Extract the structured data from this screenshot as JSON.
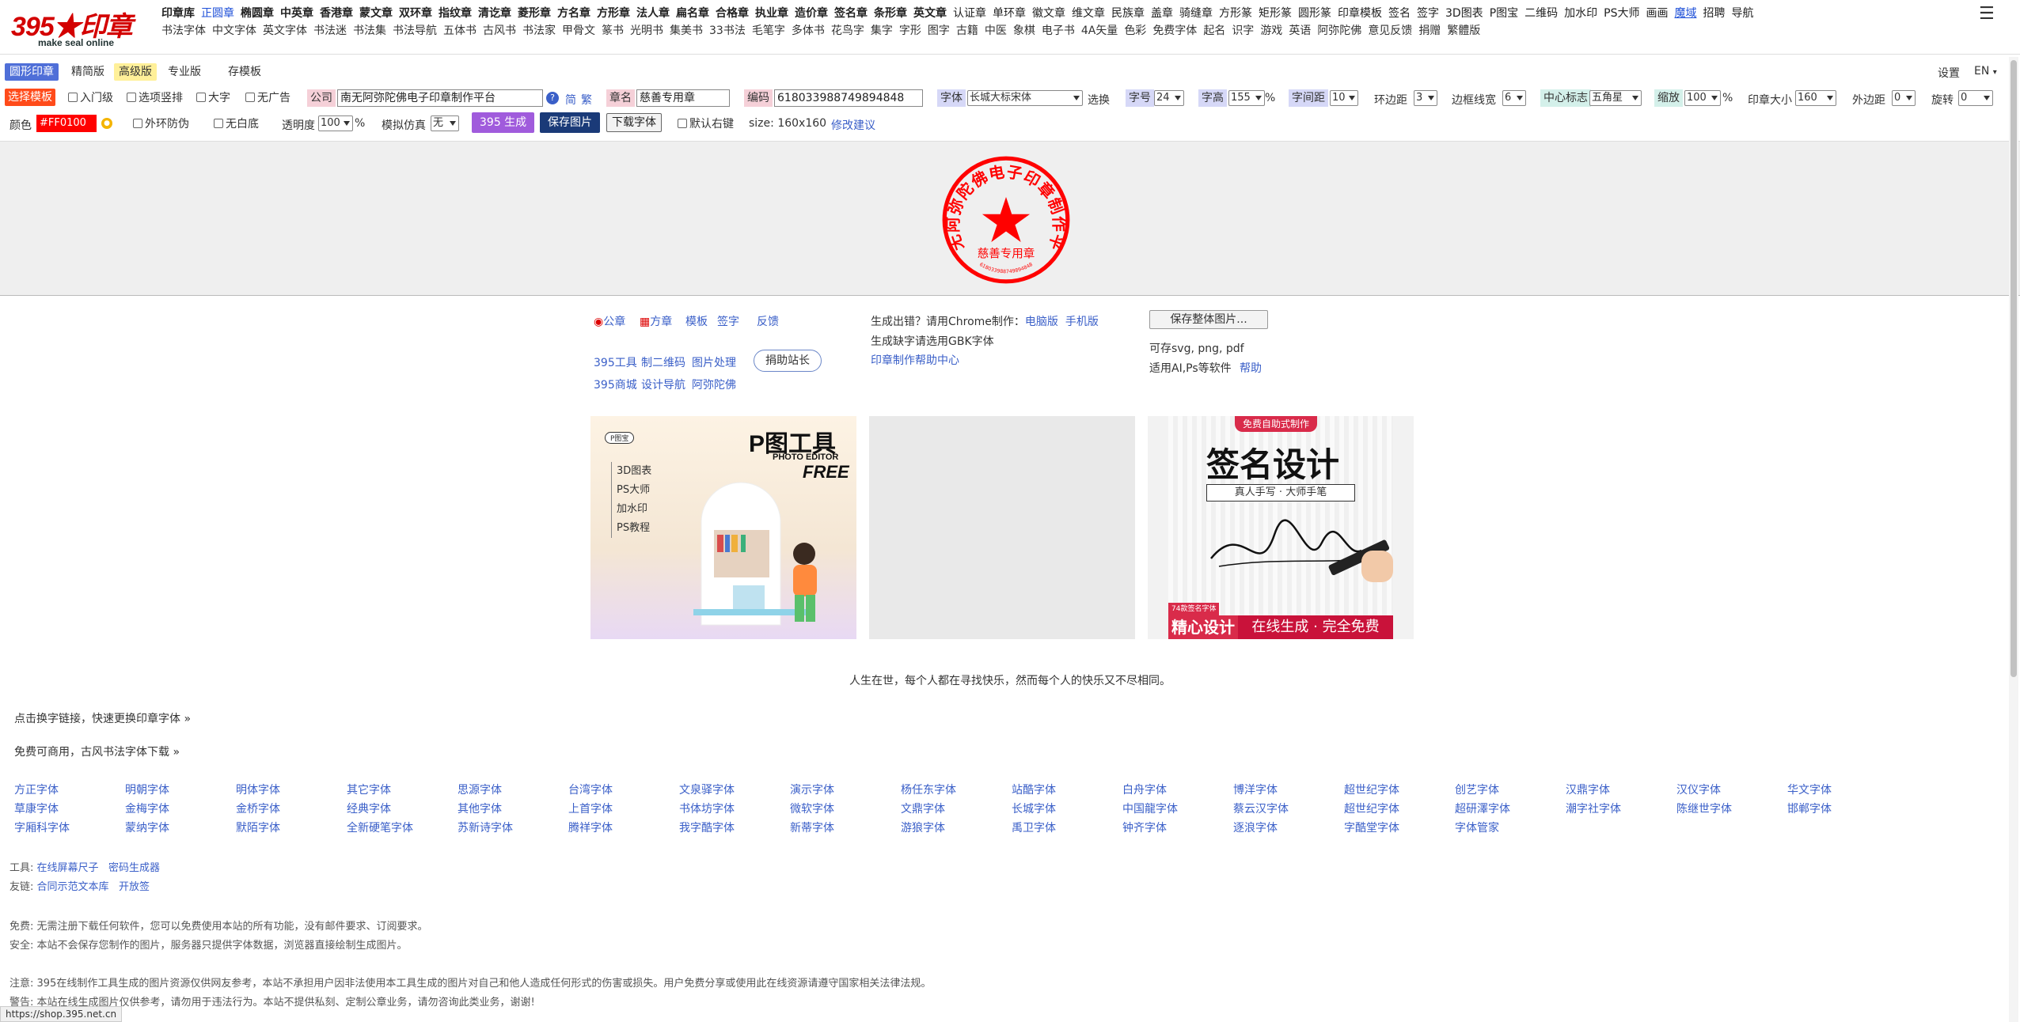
{
  "header": {
    "logo_text": "395★印章",
    "logo_sub": "make seal online",
    "nav_row1": [
      "印章库",
      "正圆章",
      "椭圆章",
      "中英章",
      "香港章",
      "蒙文章",
      "双环章",
      "指纹章",
      "清讫章",
      "菱形章",
      "方名章",
      "方形章",
      "法人章",
      "扁名章",
      "合格章",
      "执业章",
      "造价章",
      "签名章",
      "条形章",
      "英文章",
      "认证章",
      "单环章",
      "徽文章",
      "维文章",
      "民族章",
      "盖章",
      "骑缝章",
      "方形篆",
      "矩形篆",
      "圆形篆",
      "印章模板",
      "签名",
      "签字",
      "3D图表",
      "P图宝",
      "二维码",
      "加水印",
      "PS大师",
      "画画",
      "魔域",
      "招聘",
      "导航"
    ],
    "nav_row2": [
      "书法字体",
      "中文字体",
      "英文字体",
      "书法迷",
      "书法集",
      "书法导航",
      "五体书",
      "古风书",
      "书法家",
      "甲骨文",
      "篆书",
      "光明书",
      "集美书",
      "33书法",
      "毛笔字",
      "多体书",
      "花鸟字",
      "集字",
      "字形",
      "图字",
      "古籍",
      "中医",
      "象棋",
      "电子书",
      "4A矢量",
      "色彩",
      "免费字体",
      "起名",
      "识字",
      "游戏",
      "英语",
      "阿弥陀佛",
      "意见反馈",
      "捐赠",
      "繁體版"
    ],
    "menu_icon": "hamburger-icon"
  },
  "tabs": [
    "圆形印章",
    "精简版",
    "高级版",
    "专业版",
    "存模板"
  ],
  "top_right": {
    "settings": "设置",
    "lang": "EN"
  },
  "form": {
    "template_btn": "选择模板",
    "cb_entry": "入门级",
    "cb_option": "选项竖排",
    "cb_big": "大字",
    "cb_noad": "无广告",
    "company_label": "公司",
    "company_value": "南无阿弥陀佛电子印章制作平台",
    "simp": "简",
    "trad": "繁",
    "chapter_label": "章名",
    "chapter_value": "慈善专用章",
    "code_label": "编码",
    "code_value": "618033988749894848",
    "font_label": "字体",
    "font_value": "长城大标宋体",
    "font_switch": "选换",
    "size_label": "字号",
    "size_value": "24",
    "height_label": "字高",
    "height_value": "155",
    "pct": "%",
    "spacing_label": "字间距",
    "spacing_value": "10",
    "ring_label": "环边距",
    "ring_value": "3",
    "border_label": "边框线宽",
    "border_value": "6",
    "center_label": "中心标志",
    "center_value": "五角星",
    "scale_label": "缩放",
    "scale_value": "100",
    "seal_size_label": "印章大小",
    "seal_size_value": "160",
    "outer_label": "外边距",
    "outer_value": "0",
    "rotate_label": "旋转",
    "rotate_value": "0",
    "color_label": "颜色",
    "color_value": "#FF0100",
    "cb_outer": "外环防伪",
    "cb_nobg": "无白底",
    "opacity_label": "透明度",
    "opacity_value": "100",
    "sim_label": "模拟仿真",
    "sim_value": "无",
    "gen_btn": "395 生成",
    "save_btn": "保存图片",
    "download_btn": "下载字体",
    "cb_rightkey": "默认右键",
    "size_text": "size: 160x160",
    "suggest": "修改建议"
  },
  "seal": {
    "arc_text": "南无阿弥陀佛电子印章制作平台",
    "name": "慈善专用章",
    "code": "618033988749894848",
    "color": "#FF0100"
  },
  "links": {
    "official": "公章",
    "square": "方章",
    "template": "模板",
    "sign": "签字",
    "feedback": "反馈",
    "tools": [
      "395工具",
      "制二维码",
      "图片处理"
    ],
    "tools2": [
      "395商城",
      "设计导航",
      "阿弥陀佛"
    ],
    "donate": "捐助站长",
    "err_line_prefix": "生成出错？请用Chrome制作：",
    "pc": "电脑版",
    "mobile": "手机版",
    "gbk": "生成缺字请选用GBK字体",
    "help_center": "印章制作帮助中心",
    "save_all": "保存整体图片...",
    "formats": "可存svg, png, pdf",
    "ai_ps": "适用AI,Ps等软件",
    "help": "帮助"
  },
  "banners": {
    "ad1": {
      "tag": "P图宝",
      "title": "P图工具",
      "sub": "PHOTO EDITOR",
      "free": "FREE",
      "items": [
        "3D图表",
        "PS大师",
        "加水印",
        "PS教程"
      ]
    },
    "ad3": {
      "tag": "免费自助式制作",
      "title": "签名设计",
      "sub": "真人手写 · 大师手笔",
      "small": "74款签名字体",
      "bottom_left": "精心设计",
      "bottom_right": "在线生成 · 完全免费"
    }
  },
  "quote": "人生在世，每个人都在寻找快乐，然而每个人的快乐又不尽相同。",
  "font_links": {
    "change_link": "点击换字链接，快速更换印章字体 »",
    "free_link": "免费可商用，古风书法字体下载 »",
    "grid": [
      [
        "方正字体",
        "明朝字体",
        "明体字体",
        "其它字体",
        "思源字体",
        "台湾字体",
        "文泉驿字体",
        "演示字体",
        "杨任东字体",
        "站酷字体",
        "白舟字体",
        "博洋字体",
        "超世纪字体",
        "创艺字体",
        "汉鼎字体",
        "汉仪字体",
        "华文字体"
      ],
      [
        "草康字体",
        "金梅字体",
        "金桥字体",
        "经典字体",
        "其他字体",
        "上首字体",
        "书体坊字体",
        "微软字体",
        "文鼎字体",
        "长城字体",
        "中国龍字体",
        "蔡云汉字体",
        "超世纪字体",
        "超研澤字体",
        "潮字社字体",
        "陈继世字体",
        "邯郸字体"
      ],
      [
        "字厢科字体",
        "蒙纳字体",
        "默陌字体",
        "全新硬笔字体",
        "苏新诗字体",
        "腾祥字体",
        "我字酷字体",
        "新蒂字体",
        "游狼字体",
        "禹卫字体",
        "钟齐字体",
        "逐浪字体",
        "字酷堂字体",
        "字体管家"
      ]
    ]
  },
  "footer": {
    "tools_label": "工具:",
    "tools": [
      "在线屏幕尺子",
      "密码生成器"
    ],
    "friends_label": "友链:",
    "friends": [
      "合同示范文本库",
      "开放签"
    ],
    "free": "免费: 无需注册下载任何软件，您可以免费使用本站的所有功能，没有邮件要求、订阅要求。",
    "safe": "安全: 本站不会保存您制作的图片，服务器只提供字体数据，浏览器直接绘制生成图片。",
    "note": "注意: 395在线制作工具生成的图片资源仅供网友参考，本站不承担用户因非法使用本工具生成的图片对自己和他人造成任何形式的伤害或损失。用户免费分享或使用此在线资源请遵守国家相关法律法规。",
    "warn": "警告: 本站在线生成图片仅供参考，请勿用于违法行为。本站不提供私刻、定制公章业务，请勿咨询此类业务，谢谢!"
  },
  "status_url": "https://shop.395.net.cn"
}
